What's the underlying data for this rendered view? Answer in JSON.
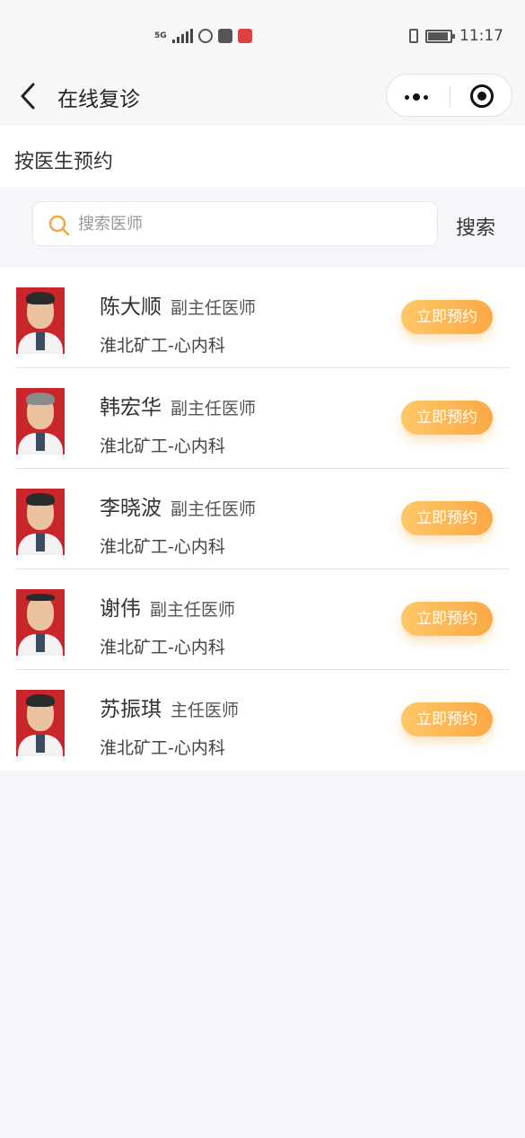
{
  "status_bar": {
    "network": "5G",
    "time": "11:17",
    "battery_level": 0.85,
    "colors": {
      "app1": "#555555",
      "app2": "#e04040"
    }
  },
  "navbar": {
    "title": "在线复诊",
    "back_icon": "chevron-left-icon",
    "more_icon": "more-dots-icon",
    "close_icon": "target-icon"
  },
  "section": {
    "title": "按医生预约"
  },
  "search": {
    "placeholder": "搜索医师",
    "value": "",
    "button": "搜索",
    "icon_color": "#f3a43b"
  },
  "doctors": [
    {
      "name": "陈大顺",
      "title": "副主任医师",
      "dept": "淮北矿工-心内科",
      "action": "立即预约"
    },
    {
      "name": "韩宏华",
      "title": "副主任医师",
      "dept": "淮北矿工-心内科",
      "action": "立即预约"
    },
    {
      "name": "李晓波",
      "title": "副主任医师",
      "dept": "淮北矿工-心内科",
      "action": "立即预约"
    },
    {
      "name": "谢伟",
      "title": "副主任医师",
      "dept": "淮北矿工-心内科",
      "action": "立即预约"
    },
    {
      "name": "苏振琪",
      "title": "主任医师",
      "dept": "淮北矿工-心内科",
      "action": "立即预约"
    }
  ],
  "colors": {
    "accent": "#fba945",
    "avatar_bg": "#c9262b",
    "page_bg": "#f4f6f9"
  }
}
